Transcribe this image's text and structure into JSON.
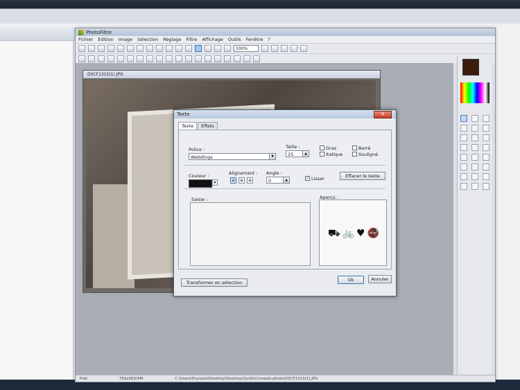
{
  "app": {
    "title": "PhotoFiltre",
    "menu": [
      "Fichier",
      "Edition",
      "Image",
      "Sélection",
      "Réglage",
      "Filtre",
      "Affichage",
      "Outils",
      "Fenêtre",
      "?"
    ],
    "zoom": "100%"
  },
  "image_window": {
    "title": "DSCF1315(1).JPG"
  },
  "statusbar": {
    "left": "Prêt",
    "size": "750x563/4M",
    "path": "C:\\Users\\François\\Desktop\\Desktop\\Outils\\Conseils-photo\\DSCF1315(1).JPG"
  },
  "dialog": {
    "title": "Texte",
    "close": "✕",
    "tabs": [
      "Texte",
      "Effets"
    ],
    "police_label": "Police :",
    "police_value": "Webdings",
    "taille_label": "Taille :",
    "taille_value": "25",
    "gras": "Gras",
    "italique": "Italique",
    "barre": "Barré",
    "souligne": "Souligné",
    "couleur_label": "Couleur :",
    "alignement_label": "Alignement :",
    "angle_label": "Angle :",
    "angle_value": "0",
    "lisser": "Lisser",
    "lisser_mark": "✓",
    "effacer": "Effacer le texte",
    "saisie_label": "Saisie :",
    "apercu_label": "Aperçu :",
    "apercu_glyphs": "⛟🚲♥🚭",
    "transformer": "Transformer en sélection",
    "ok": "Ok",
    "annuler": "Annuler"
  },
  "colors": {
    "foreground_swatch": "#3c1c0b",
    "text_color": "#111111"
  }
}
